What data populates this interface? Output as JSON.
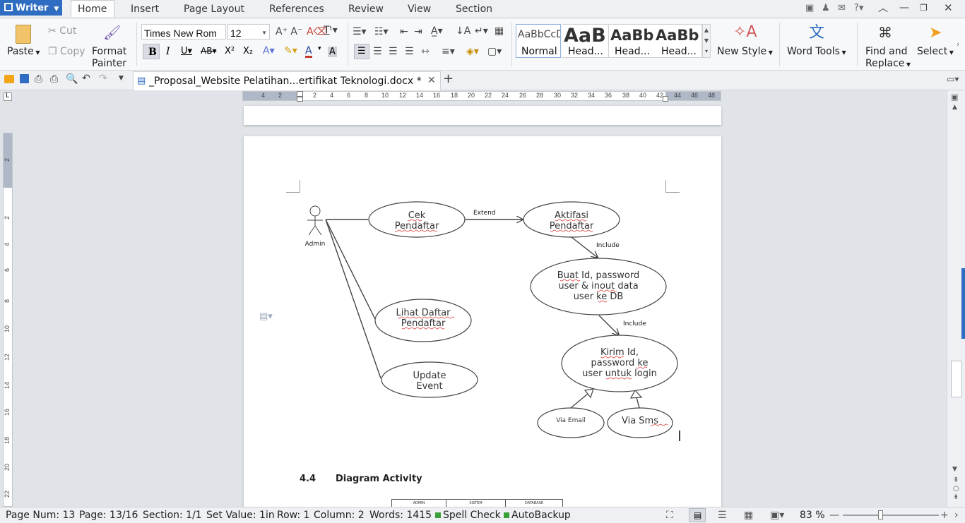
{
  "app": {
    "name": "Writer"
  },
  "menu": {
    "tabs": [
      "Home",
      "Insert",
      "Page Layout",
      "References",
      "Review",
      "View",
      "Section"
    ]
  },
  "ribbon": {
    "paste": "Paste",
    "cut": "Cut",
    "copy": "Copy",
    "format_painter_1": "Format",
    "format_painter_2": "Painter",
    "font_name": "Times New Rom",
    "font_size": "12",
    "styles": [
      {
        "preview": "AaBbCcD",
        "name": "Normal"
      },
      {
        "preview": "AaB",
        "name": "Head..."
      },
      {
        "preview": "AaBb",
        "name": "Head..."
      },
      {
        "preview": "AaBb",
        "name": "Head..."
      }
    ],
    "new_style": "New Style",
    "word_tools": "Word Tools",
    "find_replace_1": "Find and",
    "find_replace_2": "Replace",
    "select": "Select"
  },
  "document": {
    "tab_title": "_Proposal_Website Pelatihan...ertifikat Teknologi.docx *"
  },
  "ruler": {
    "h_ticks": [
      "4",
      "2",
      "2",
      "4",
      "6",
      "8",
      "10",
      "12",
      "14",
      "16",
      "18",
      "20",
      "22",
      "24",
      "26",
      "28",
      "30",
      "32",
      "34",
      "36",
      "38",
      "40",
      "42",
      "44",
      "46",
      "48"
    ],
    "v_ticks": [
      "2",
      "2",
      "4",
      "6",
      "8",
      "10",
      "12",
      "14",
      "16",
      "18",
      "20",
      "22"
    ]
  },
  "diagram": {
    "actor": "Admin",
    "cek_1": "Cek",
    "cek_2": "Pendaftar",
    "aktifasi_1": "Aktifasi",
    "aktifasi_2": "Pendaftar",
    "extend": "Extend",
    "include_1": "Include",
    "include_2": "Include",
    "buat_1": "Buat Id, password",
    "buat_2": "user & inout data",
    "buat_3": "user ke DB",
    "lihat_1": "Lihat Daftar",
    "lihat_2": "Pendaftar",
    "update_1": "Update",
    "update_2": "Event",
    "kirim_1": "Kirim Id,",
    "kirim_2": "password ke",
    "kirim_3": "user untuk login",
    "via_email": "Via Email",
    "via_sms": "Via Sms"
  },
  "section_heading": {
    "number": "4.4",
    "title": "Diagram Activity"
  },
  "swimlanes": [
    "ADMIN",
    "SISTEM",
    "DATABASE"
  ],
  "status": {
    "page_num": "Page Num: 13",
    "page": "Page: 13/16",
    "section": "Section: 1/1",
    "set_value": "Set Value: 1in",
    "row": "Row: 1",
    "column": "Column: 2",
    "words": "Words: 1415",
    "spell_check": "Spell Check",
    "autobackup": "AutoBackup",
    "zoom": "83 %"
  },
  "colors": {
    "accent": "#2e6dc1",
    "page": "#ffffff",
    "workspace": "#e0e3e7",
    "status_green": "#3aa13a"
  }
}
